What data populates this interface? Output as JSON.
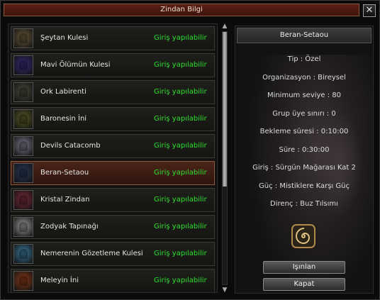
{
  "window": {
    "title": "Zindan Bilgi",
    "close_label": "✕"
  },
  "dungeons": [
    {
      "name": "Şeytan Kulesi",
      "status": "Giriş yapılabilir",
      "thumb_color": "#6a5a3a",
      "icon": "demon-tower-icon"
    },
    {
      "name": "Mavi Ölümün Kulesi",
      "status": "Giriş yapılabilir",
      "thumb_color": "#3a2a7a",
      "icon": "blue-death-tower-icon"
    },
    {
      "name": "Ork Labirenti",
      "status": "Giriş yapılabilir",
      "thumb_color": "#4a4a3a",
      "icon": "orc-maze-icon"
    },
    {
      "name": "Baronesin İni",
      "status": "Giriş yapılabilir",
      "thumb_color": "#5a5a2a",
      "icon": "baroness-lair-icon"
    },
    {
      "name": "Devils Catacomb",
      "status": "Giriş yapılabilir",
      "thumb_color": "#7a7a8a",
      "icon": "devils-catacomb-icon"
    },
    {
      "name": "Beran-Setaou",
      "status": "Giriş yapılabilir",
      "thumb_color": "#2a3a5a",
      "icon": "beran-setaou-icon"
    },
    {
      "name": "Kristal Zindan",
      "status": "Giriş yapılabilir",
      "thumb_color": "#7a2a3a",
      "icon": "crystal-dungeon-icon"
    },
    {
      "name": "Zodyak Tapınağı",
      "status": "Giriş yapılabilir",
      "thumb_color": "#9a9a9a",
      "icon": "zodiac-temple-icon"
    },
    {
      "name": "Nemerenin Gözetleme Kulesi",
      "status": "Giriş yapılabilir",
      "thumb_color": "#3a7a9a",
      "icon": "nemere-watchtower-icon"
    },
    {
      "name": "Meleyin İni",
      "status": "Giriş yapılabilir",
      "thumb_color": "#8a3a1a",
      "icon": "meley-lair-icon"
    }
  ],
  "selected_index": 5,
  "detail": {
    "title": "Beran-Setaou",
    "lines": [
      "Tip : Özel",
      "Organizasyon : Bireysel",
      "Minimum seviye : 80",
      "Grup üye sınırı : 0",
      "Bekleme süresi : 0:10:00",
      "Süre : 0:30:00",
      "Giriş : Sürgün Mağarası Kat 2",
      "Güç : Mistiklere Karşı Güç",
      "Direnç : Buz Tılsımı"
    ],
    "emblem_icon": "spiral-talisman-icon",
    "teleport_label": "Işınlan",
    "close_label": "Kapat"
  },
  "colors": {
    "status_green": "#2fe02f",
    "accent_border": "#8b5a3c"
  }
}
